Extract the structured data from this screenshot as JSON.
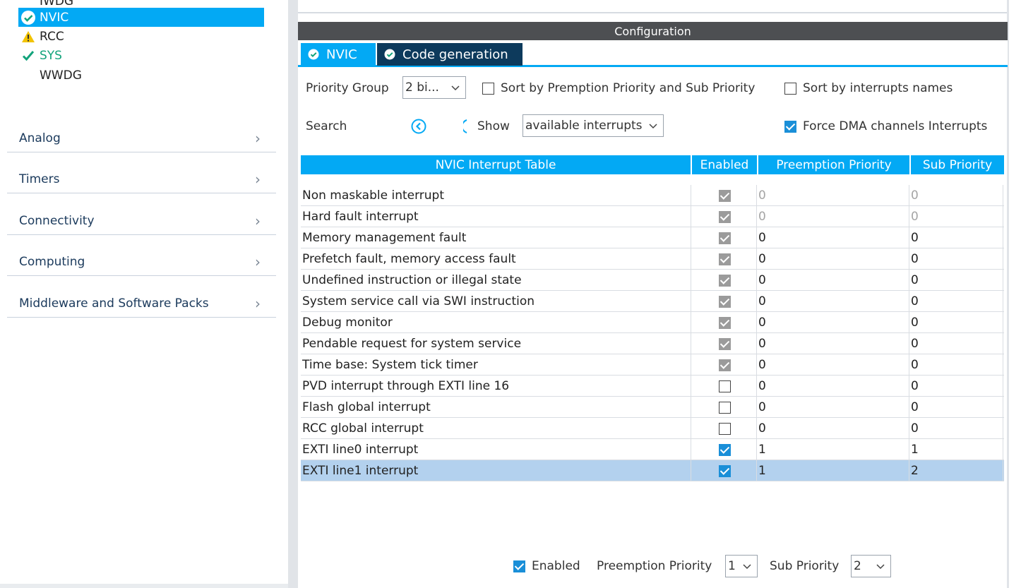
{
  "sidebar": {
    "peripherals": [
      {
        "label": "IWDG",
        "status": "none"
      },
      {
        "label": "NVIC",
        "status": "selected"
      },
      {
        "label": "RCC",
        "status": "warning"
      },
      {
        "label": "SYS",
        "status": "ok"
      },
      {
        "label": "WWDG",
        "status": "none"
      }
    ],
    "categories": [
      {
        "label": "Analog"
      },
      {
        "label": "Timers"
      },
      {
        "label": "Connectivity"
      },
      {
        "label": "Computing"
      },
      {
        "label": "Middleware and Software Packs"
      }
    ]
  },
  "config": {
    "title": "Configuration",
    "tabs": [
      {
        "label": "NVIC"
      },
      {
        "label": "Code generation"
      }
    ],
    "priority_group_label": "Priority Group",
    "priority_group_value": "2 bi...",
    "sort_premption_label": "Sort by Premption Priority and Sub Priority",
    "sort_premption_checked": false,
    "sort_names_label": "Sort by interrupts names",
    "sort_names_checked": false,
    "search_label": "Search",
    "show_label": "Show",
    "show_value": "available interrupts",
    "force_dma_label": "Force DMA channels Interrupts",
    "force_dma_checked": true
  },
  "table": {
    "headers": [
      "NVIC Interrupt Table",
      "Enabled",
      "Preemption Priority",
      "Sub Priority"
    ],
    "rows": [
      {
        "name": "Non maskable interrupt",
        "enabled": "locked",
        "pre": "0",
        "sub": "0",
        "dim": true
      },
      {
        "name": "Hard fault interrupt",
        "enabled": "locked",
        "pre": "0",
        "sub": "0",
        "dim": true
      },
      {
        "name": "Memory management fault",
        "enabled": "locked",
        "pre": "0",
        "sub": "0",
        "dim": false
      },
      {
        "name": "Prefetch fault, memory access fault",
        "enabled": "locked",
        "pre": "0",
        "sub": "0",
        "dim": false
      },
      {
        "name": "Undefined instruction or illegal state",
        "enabled": "locked",
        "pre": "0",
        "sub": "0",
        "dim": false
      },
      {
        "name": "System service call via SWI instruction",
        "enabled": "locked",
        "pre": "0",
        "sub": "0",
        "dim": false
      },
      {
        "name": "Debug monitor",
        "enabled": "locked",
        "pre": "0",
        "sub": "0",
        "dim": false
      },
      {
        "name": "Pendable request for system service",
        "enabled": "locked",
        "pre": "0",
        "sub": "0",
        "dim": false
      },
      {
        "name": "Time base: System tick timer",
        "enabled": "locked",
        "pre": "0",
        "sub": "0",
        "dim": false
      },
      {
        "name": "PVD interrupt through EXTI line 16",
        "enabled": "off",
        "pre": "0",
        "sub": "0",
        "dim": false
      },
      {
        "name": "Flash global interrupt",
        "enabled": "off",
        "pre": "0",
        "sub": "0",
        "dim": false
      },
      {
        "name": "RCC global interrupt",
        "enabled": "off",
        "pre": "0",
        "sub": "0",
        "dim": false
      },
      {
        "name": "EXTI line0 interrupt",
        "enabled": "on",
        "pre": "1",
        "sub": "1",
        "dim": false
      },
      {
        "name": "EXTI line1 interrupt",
        "enabled": "on",
        "pre": "1",
        "sub": "2",
        "dim": false,
        "selected": true
      }
    ]
  },
  "detail": {
    "enabled_label": "Enabled",
    "enabled_checked": true,
    "preemption_label": "Preemption Priority",
    "preemption_value": "1",
    "sub_label": "Sub Priority",
    "sub_value": "2"
  },
  "colors": {
    "accent": "#03a9f4",
    "tab_dark": "#0d3a5c",
    "ok_green": "#12a37b",
    "warning": "#f2c300",
    "row_selected": "#b3d1ee"
  }
}
